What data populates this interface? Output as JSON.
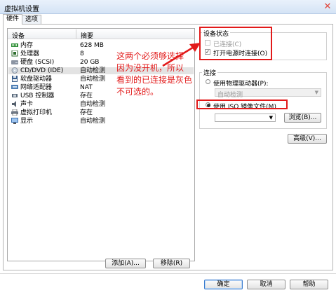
{
  "window": {
    "title": "虚拟机设置",
    "close_glyph": "✕"
  },
  "tabs": [
    {
      "label": "硬件",
      "active": true
    },
    {
      "label": "选项",
      "active": false
    }
  ],
  "device_table": {
    "col_device": "设备",
    "col_summary": "摘要",
    "rows": [
      {
        "icon": "memory-icon",
        "name": "内存",
        "summary": "628 MB"
      },
      {
        "icon": "processor-icon",
        "name": "处理器",
        "summary": "8"
      },
      {
        "icon": "hard-disk-icon",
        "name": "硬盘 (SCSI)",
        "summary": "20 GB"
      },
      {
        "icon": "cd-dvd-icon",
        "name": "CD/DVD (IDE)",
        "summary": "自动检测",
        "selected": true
      },
      {
        "icon": "floppy-icon",
        "name": "软盘驱动器",
        "summary": "自动检测"
      },
      {
        "icon": "network-adapter-icon",
        "name": "网络适配器",
        "summary": "NAT"
      },
      {
        "icon": "usb-controller-icon",
        "name": "USB 控制器",
        "summary": "存在"
      },
      {
        "icon": "sound-card-icon",
        "name": "声卡",
        "summary": "自动检测"
      },
      {
        "icon": "printer-icon",
        "name": "虚拟打印机",
        "summary": "存在"
      },
      {
        "icon": "display-icon",
        "name": "显示",
        "summary": "自动检测"
      }
    ]
  },
  "device_buttons": {
    "add": "添加(A)...",
    "remove": "移除(R)"
  },
  "device_status": {
    "title": "设备状态",
    "connected": "已连接(C)",
    "connect_at_power_on": "打开电源时连接(O)"
  },
  "connection": {
    "title": "连接",
    "use_physical_drive": "使用物理驱动器(P):",
    "physical_drive_value": "自动检测",
    "use_iso": "使用 ISO 镜像文件(M)",
    "iso_path": "",
    "browse": "浏览(B)..."
  },
  "advanced_button": "高级(V)...",
  "dialog_buttons": {
    "ok": "确定",
    "cancel": "取消",
    "help": "帮助"
  },
  "annotation": {
    "line1": "这两个必须够选择",
    "line2": "因为没开机，所以",
    "line3": "看到的已连接是灰色",
    "line4": "不可选的。"
  },
  "colors": {
    "annotation": "#e21a1a",
    "selection": "#e3e3e3",
    "default_button": "#3a7ccf"
  }
}
